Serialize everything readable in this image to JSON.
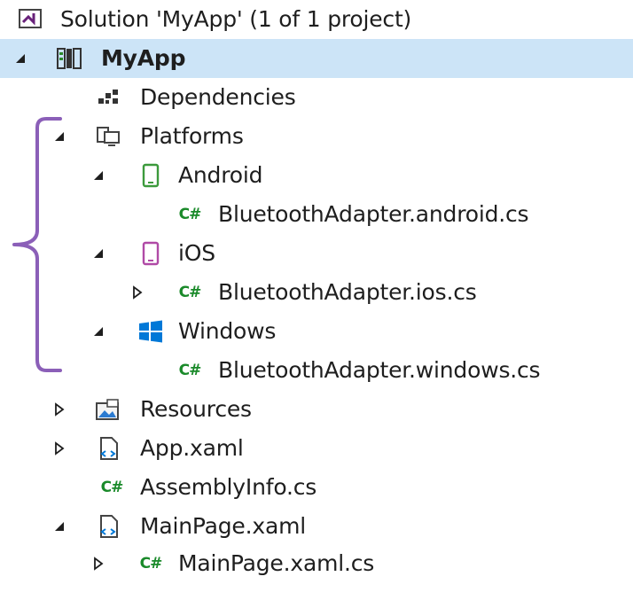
{
  "solution_explorer": {
    "solution_label": "Solution 'MyApp' (1 of 1 project)",
    "project": {
      "label": "MyApp",
      "selected": true
    },
    "items": {
      "dependencies": "Dependencies",
      "platforms": "Platforms",
      "android": "Android",
      "android_file": "BluetoothAdapter.android.cs",
      "ios": "iOS",
      "ios_file": "BluetoothAdapter.ios.cs",
      "windows": "Windows",
      "windows_file": "BluetoothAdapter.windows.cs",
      "resources": "Resources",
      "app_xaml": "App.xaml",
      "assemblyinfo": "AssemblyInfo.cs",
      "mainpage_xaml": "MainPage.xaml",
      "mainpage_xaml_cs": "MainPage.xaml.cs"
    },
    "csharp_glyph": "C#"
  },
  "colors": {
    "selection": "#cce4f7",
    "csharp": "#1a8a2a",
    "android": "#3c9a3c",
    "ios": "#b04aa6",
    "windows": "#0078d7",
    "bracket": "#8b5fb8",
    "visual_studio": "#68217a"
  },
  "icons": {
    "solution": "visual-studio-solution-icon",
    "project": "project-icon",
    "dependencies": "dependencies-icon",
    "platforms": "platforms-icon",
    "android": "android-phone-icon",
    "ios": "ios-phone-icon",
    "windows": "windows-logo-icon",
    "csharp": "csharp-file-icon",
    "resources": "resources-folder-icon",
    "xaml": "xaml-file-icon"
  }
}
